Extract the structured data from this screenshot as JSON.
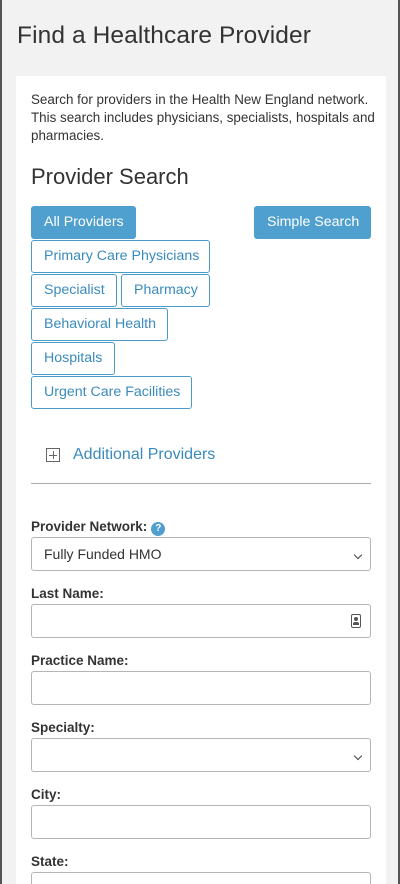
{
  "page": {
    "title": "Find a Healthcare Provider"
  },
  "intro": {
    "text": "Search for providers in the Health New England network. This search includes physicians, specialists, hospitals and pharmacies."
  },
  "provider_search": {
    "title": "Provider Search",
    "all_providers": "All Providers",
    "simple_search": "Simple Search",
    "primary_care": "Primary Care Physicians",
    "specialist": "Specialist",
    "pharmacy": "Pharmacy",
    "behavioral_health": "Behavioral Health",
    "hospitals": "Hospitals",
    "urgent_care": "Urgent Care Facilities",
    "additional_providers": "Additional Providers"
  },
  "form": {
    "provider_network": {
      "label": "Provider Network:",
      "help": "?",
      "value": "Fully Funded HMO"
    },
    "last_name": {
      "label": "Last Name:",
      "value": ""
    },
    "practice_name": {
      "label": "Practice Name:",
      "value": ""
    },
    "specialty": {
      "label": "Specialty:",
      "value": ""
    },
    "city": {
      "label": "City:",
      "value": ""
    },
    "state": {
      "label": "State:"
    }
  },
  "colors": {
    "accent": "#4f9fcf",
    "link": "#3a8bbd",
    "background": "#f2f2f2"
  },
  "icons": [
    "help-icon",
    "plus-box-icon",
    "chevron-down-icon",
    "contact-card-icon"
  ]
}
